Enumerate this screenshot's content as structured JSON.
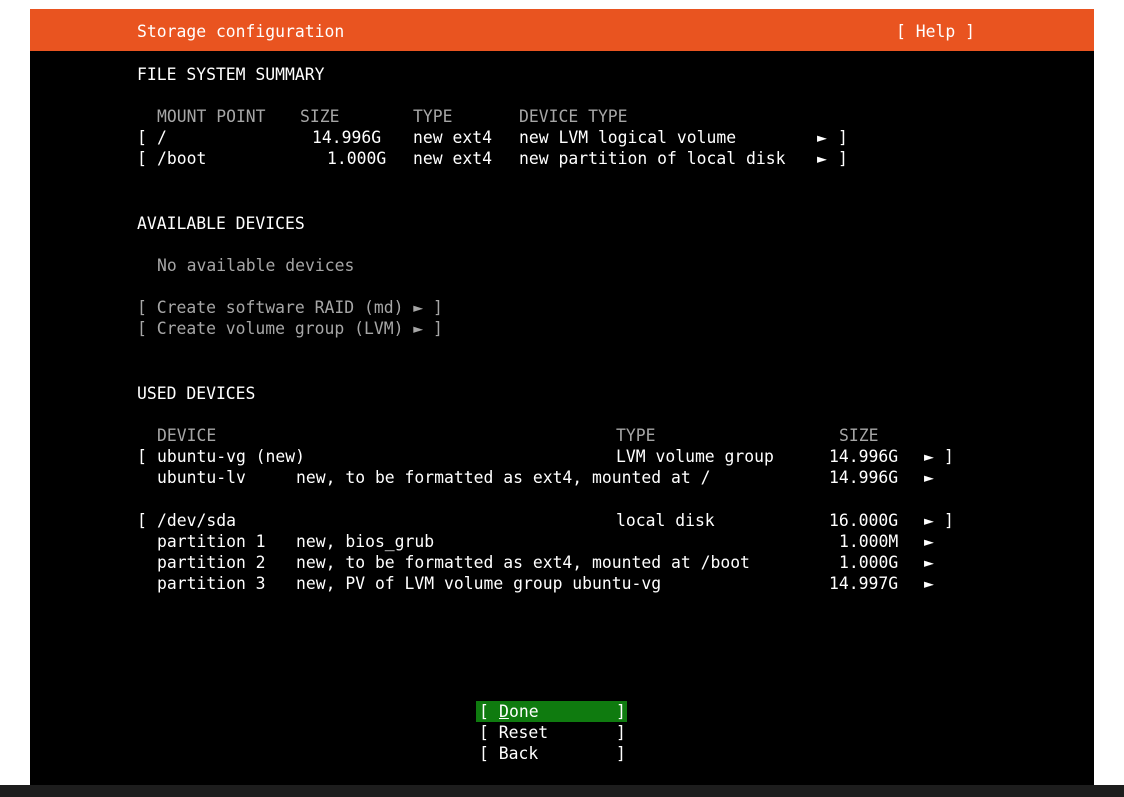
{
  "header": {
    "title": "Storage configuration",
    "help": "[ Help ]"
  },
  "fs_summary": {
    "heading": "FILE SYSTEM SUMMARY",
    "columns": [
      "MOUNT POINT",
      "SIZE",
      "TYPE",
      "DEVICE TYPE"
    ],
    "rows": [
      {
        "open": "[",
        "mount": "/",
        "size": "14.996G",
        "type": "new ext4",
        "device_type": "new LVM logical volume",
        "arrow": "►",
        "close": "]"
      },
      {
        "open": "[",
        "mount": "/boot",
        "size": "1.000G",
        "type": "new ext4",
        "device_type": "new partition of local disk",
        "arrow": "►",
        "close": "]"
      }
    ]
  },
  "available": {
    "heading": "AVAILABLE DEVICES",
    "empty_text": "No available devices",
    "actions": [
      "[ Create software RAID (md) ► ]",
      "[ Create volume group (LVM) ► ]"
    ]
  },
  "used": {
    "heading": "USED DEVICES",
    "columns": [
      "DEVICE",
      "TYPE",
      "SIZE"
    ],
    "groups": [
      {
        "open": "[",
        "device": "ubuntu-vg (new)",
        "type": "LVM volume group",
        "size": "14.996G",
        "arrow": "►",
        "close": "]",
        "children": [
          {
            "name": "ubuntu-lv",
            "desc": "new, to be formatted as ext4, mounted at /",
            "size": "14.996G",
            "arrow": "►"
          }
        ]
      },
      {
        "open": "[",
        "device": "/dev/sda",
        "type": "local disk",
        "size": "16.000G",
        "arrow": "►",
        "close": "]",
        "children": [
          {
            "name": "partition 1",
            "desc": "new, bios_grub",
            "size": "1.000M",
            "arrow": "►"
          },
          {
            "name": "partition 2",
            "desc": "new, to be formatted as ext4, mounted at /boot",
            "size": "1.000G",
            "arrow": "►"
          },
          {
            "name": "partition 3",
            "desc": "new, PV of LVM volume group ubuntu-vg",
            "size": "14.997G",
            "arrow": "►"
          }
        ]
      }
    ]
  },
  "buttons": {
    "done": {
      "open": "[ ",
      "hotkey": "D",
      "rest": "one",
      "close": "]"
    },
    "reset": {
      "label": "[ Reset",
      "close": "]"
    },
    "back": {
      "label": "[ Back",
      "close": "]"
    }
  },
  "colors": {
    "header_bg": "#e95420",
    "focus_bg": "#0f7b0f",
    "dim_text": "#a6a6a6"
  }
}
